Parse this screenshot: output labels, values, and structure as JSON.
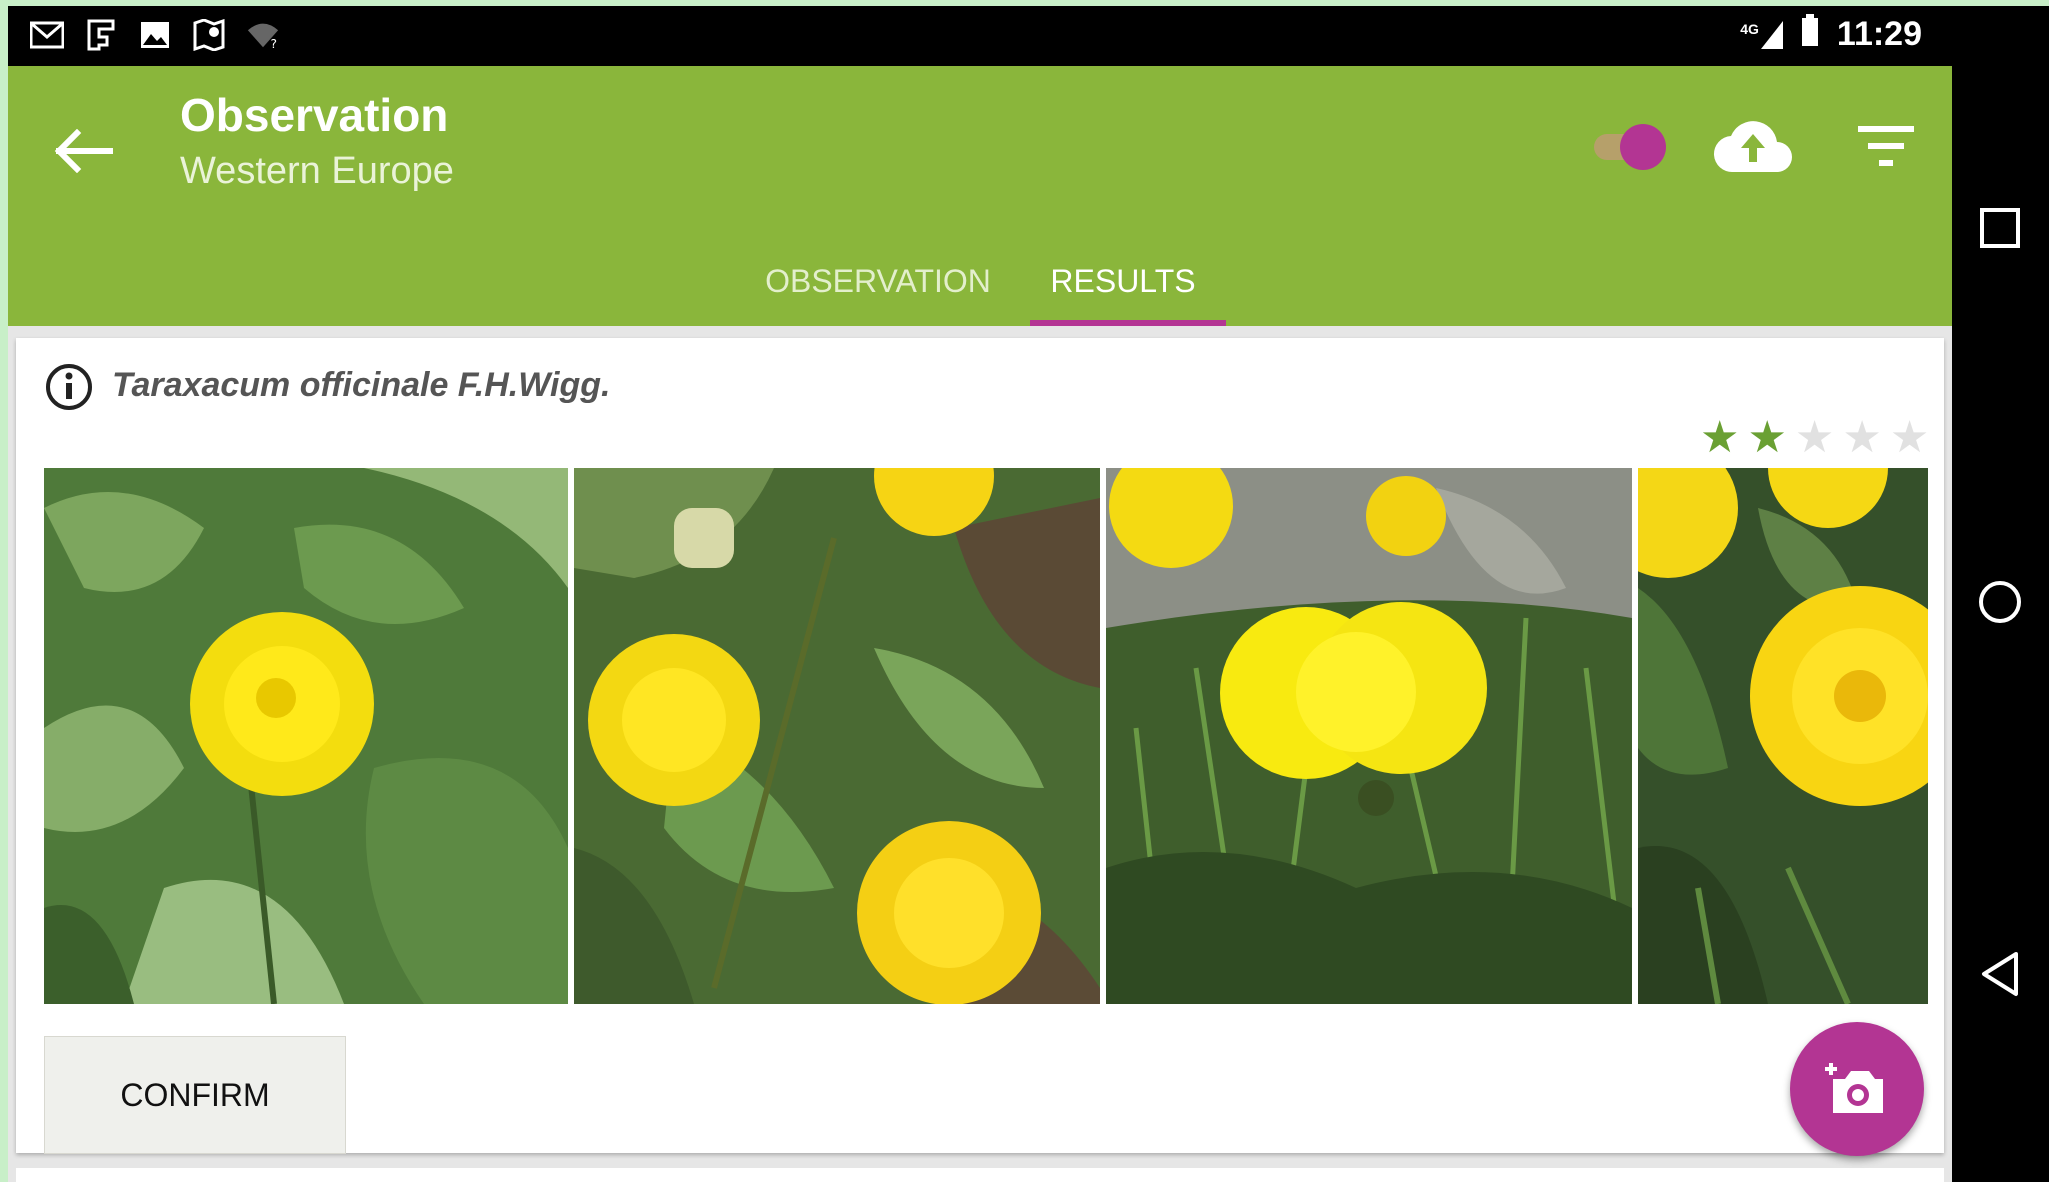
{
  "status_bar": {
    "icons": [
      "gmail-icon",
      "flipboard-icon",
      "image-icon",
      "maps-icon",
      "wifi-icon"
    ],
    "network": "4G",
    "time": "11:29"
  },
  "app_bar": {
    "title": "Observation",
    "subtitle": "Western Europe",
    "toggle_on": true,
    "colors": {
      "primary": "#8ab63b",
      "accent": "#b33593"
    }
  },
  "tabs": [
    {
      "label": "OBSERVATION",
      "selected": false
    },
    {
      "label": "RESULTS",
      "selected": true
    }
  ],
  "result": {
    "species": "Taraxacum officinale F.H.Wigg.",
    "rating": 2,
    "rating_max": 5,
    "photos": [
      "dandelion-photo-1",
      "dandelion-photo-2",
      "dandelion-photo-3",
      "dandelion-photo-4"
    ],
    "confirm_label": "CONFIRM"
  },
  "fab": {
    "icon": "add-photo-icon"
  },
  "nav_bar": {
    "icons": [
      "recents-icon",
      "home-icon",
      "back-icon"
    ]
  }
}
